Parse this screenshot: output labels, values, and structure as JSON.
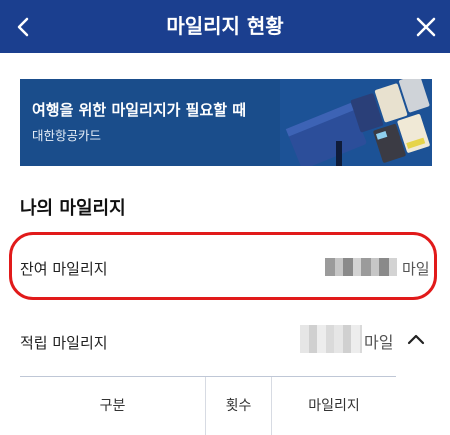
{
  "header": {
    "title": "마일리지 현황",
    "back_icon": "chevron-left-icon",
    "close_icon": "close-icon"
  },
  "banner": {
    "headline": "여행을 위한 마일리지가 필요할 때",
    "sub": "대한항공카드"
  },
  "section_title": "나의 마일리지",
  "remaining": {
    "label": "잔여 마일리지",
    "unit": "마일"
  },
  "accrued": {
    "label": "적립 마일리지",
    "unit": "마일",
    "chevron_icon": "chevron-up-icon"
  },
  "table": {
    "headers": [
      "구분",
      "횟수",
      "마일리지"
    ]
  },
  "colors": {
    "header_bg": "#1b3f8f",
    "highlight": "#e11a1a"
  }
}
